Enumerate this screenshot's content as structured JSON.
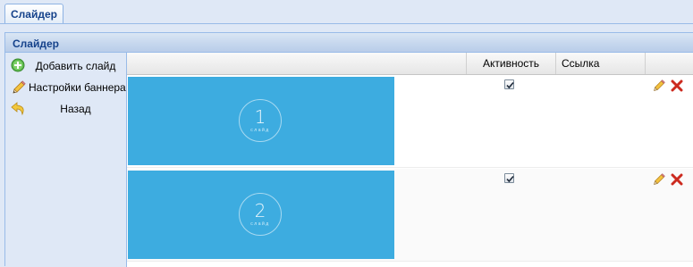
{
  "tab": {
    "label": "Слайдер"
  },
  "panel": {
    "title": "Слайдер"
  },
  "sidebar": {
    "items": [
      {
        "label": "Добавить слайд",
        "icon": "add-icon"
      },
      {
        "label": "Настройки баннера",
        "icon": "pencil-icon"
      },
      {
        "label": "Назад",
        "icon": "back-arrow-icon"
      }
    ]
  },
  "grid": {
    "columns": [
      {
        "label": ""
      },
      {
        "label": "Активность"
      },
      {
        "label": "Ссылка"
      },
      {
        "label": ""
      }
    ],
    "rows": [
      {
        "number": "1",
        "caption": "слайд",
        "active": true,
        "link": ""
      },
      {
        "number": "2",
        "caption": "слайд",
        "active": true,
        "link": ""
      }
    ],
    "actions": {
      "edit_icon": "pencil-icon",
      "delete_icon": "delete-x-icon"
    }
  },
  "colors": {
    "slide_bg": "#3dace0",
    "header_text": "#15428b",
    "delete": "#cc2a1f"
  }
}
